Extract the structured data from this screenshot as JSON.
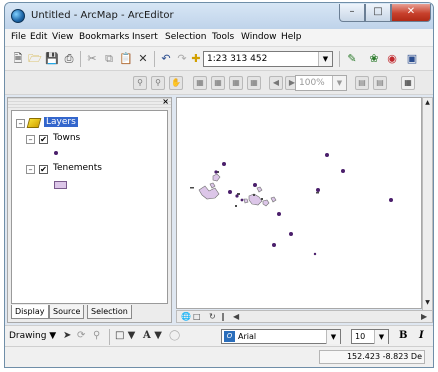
{
  "window": {
    "title": "Untitled - ArcMap - ArcEditor"
  },
  "menubar": {
    "items": [
      "File",
      "Edit",
      "View",
      "Bookmarks",
      "Insert",
      "Selection",
      "Tools",
      "Window",
      "Help"
    ]
  },
  "toolbar": {
    "scale": "1:23 313 452",
    "zoom_percent": "100%"
  },
  "toc": {
    "root_layer": "Layers",
    "layers": [
      {
        "name": "Towns",
        "checked": true,
        "symbol": "point",
        "color": "#4b1f6b"
      },
      {
        "name": "Tenements",
        "checked": true,
        "symbol": "polygon",
        "color": "#dcc6e8"
      }
    ],
    "tabs": [
      "Display",
      "Source",
      "Selection"
    ]
  },
  "drawing_toolbar": {
    "label": "Drawing",
    "font": "Arial",
    "font_size": "10",
    "bold": "B",
    "italic": "I"
  },
  "status": {
    "coordinates": "152.423  -8.823 De"
  },
  "map": {
    "town_color": "#4b1f6b",
    "tenement_color": "#dcc6e8"
  }
}
